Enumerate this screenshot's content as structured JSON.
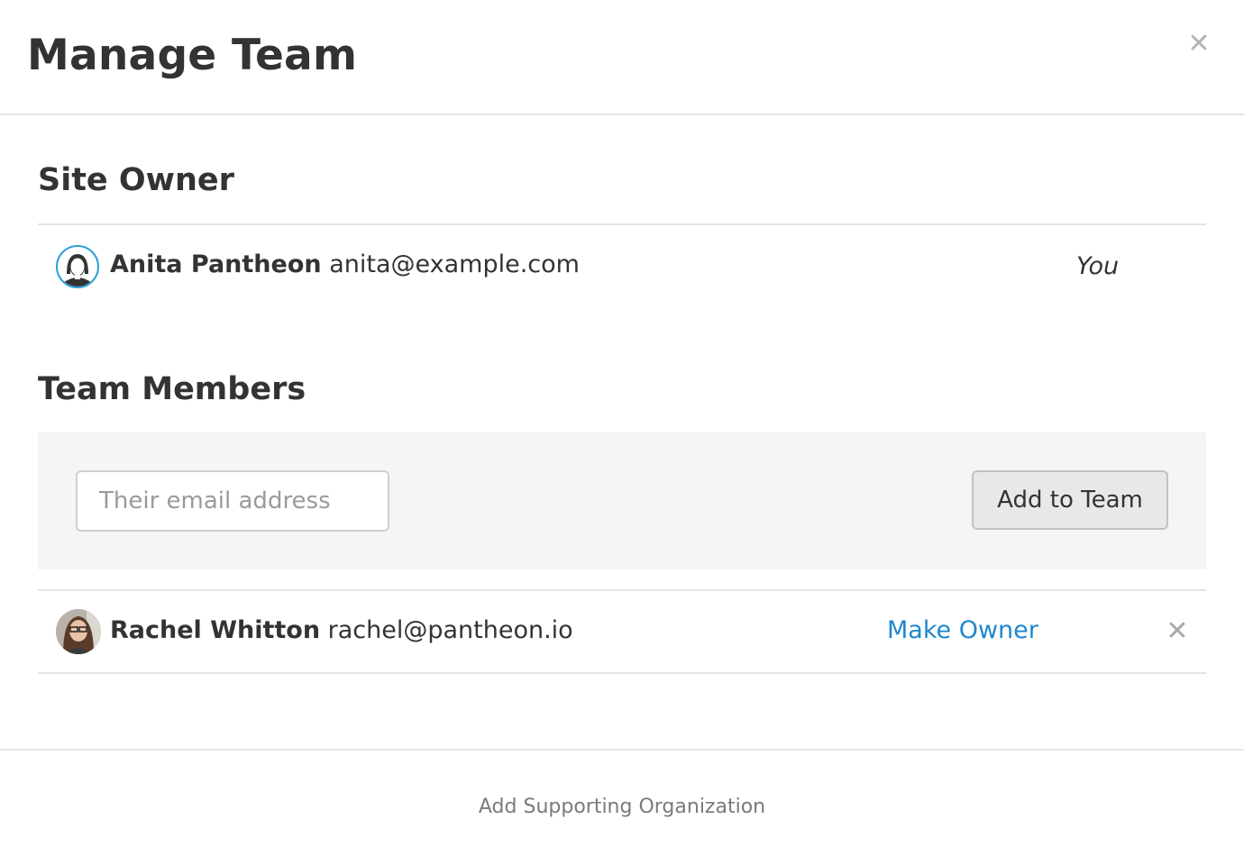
{
  "modal": {
    "title": "Manage Team",
    "close_icon": "close-icon"
  },
  "site_owner": {
    "heading": "Site Owner",
    "name": "Anita Pantheon",
    "email": "anita@example.com",
    "badge": "You",
    "avatar_icon": "default-avatar-icon"
  },
  "team_members": {
    "heading": "Team Members",
    "email_placeholder": "Their email address",
    "email_value": "",
    "add_button_label": "Add to Team",
    "members": [
      {
        "name": "Rachel Whitton",
        "email": "rachel@pantheon.io",
        "action_label": "Make Owner",
        "remove_icon": "close-icon"
      }
    ]
  },
  "footer": {
    "link_label": "Add Supporting Organization"
  },
  "colors": {
    "link": "#1f87cf",
    "avatar_ring": "#2a9fd6",
    "panel_bg": "#f4f5f6"
  }
}
